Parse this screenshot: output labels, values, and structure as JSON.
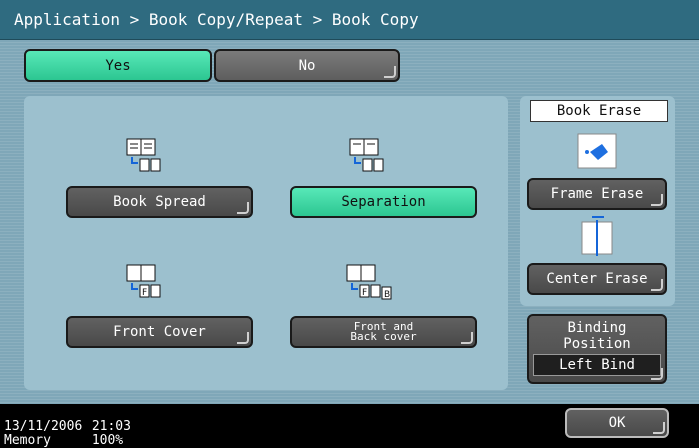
{
  "breadcrumb": "Application > Book Copy/Repeat > Book Copy",
  "toggle": {
    "yes_label": "Yes",
    "no_label": "No",
    "selected": "Yes"
  },
  "modes": {
    "book_spread": "Book Spread",
    "separation": "Separation",
    "front_cover": "Front Cover",
    "front_back_line1": "Front and",
    "front_back_line2": "Back cover",
    "selected": "Separation"
  },
  "book_erase": {
    "title": "Book Erase",
    "frame_erase": "Frame Erase",
    "center_erase": "Center Erase"
  },
  "binding": {
    "line1": "Binding",
    "line2": "Position",
    "value": "Left Bind"
  },
  "ok_label": "OK",
  "status": {
    "date": "13/11/2006",
    "time": "21:03",
    "memory_label": "Memory",
    "memory_value": "100%"
  },
  "colors": {
    "accent_green": "#2cc691",
    "title_bar": "#2f6b80"
  },
  "icons": {
    "book_spread": "book-spread-icon",
    "separation": "separation-icon",
    "front_cover": "front-cover-icon",
    "front_back": "front-back-cover-icon",
    "frame_erase": "frame-erase-icon",
    "center_erase": "center-erase-icon"
  }
}
